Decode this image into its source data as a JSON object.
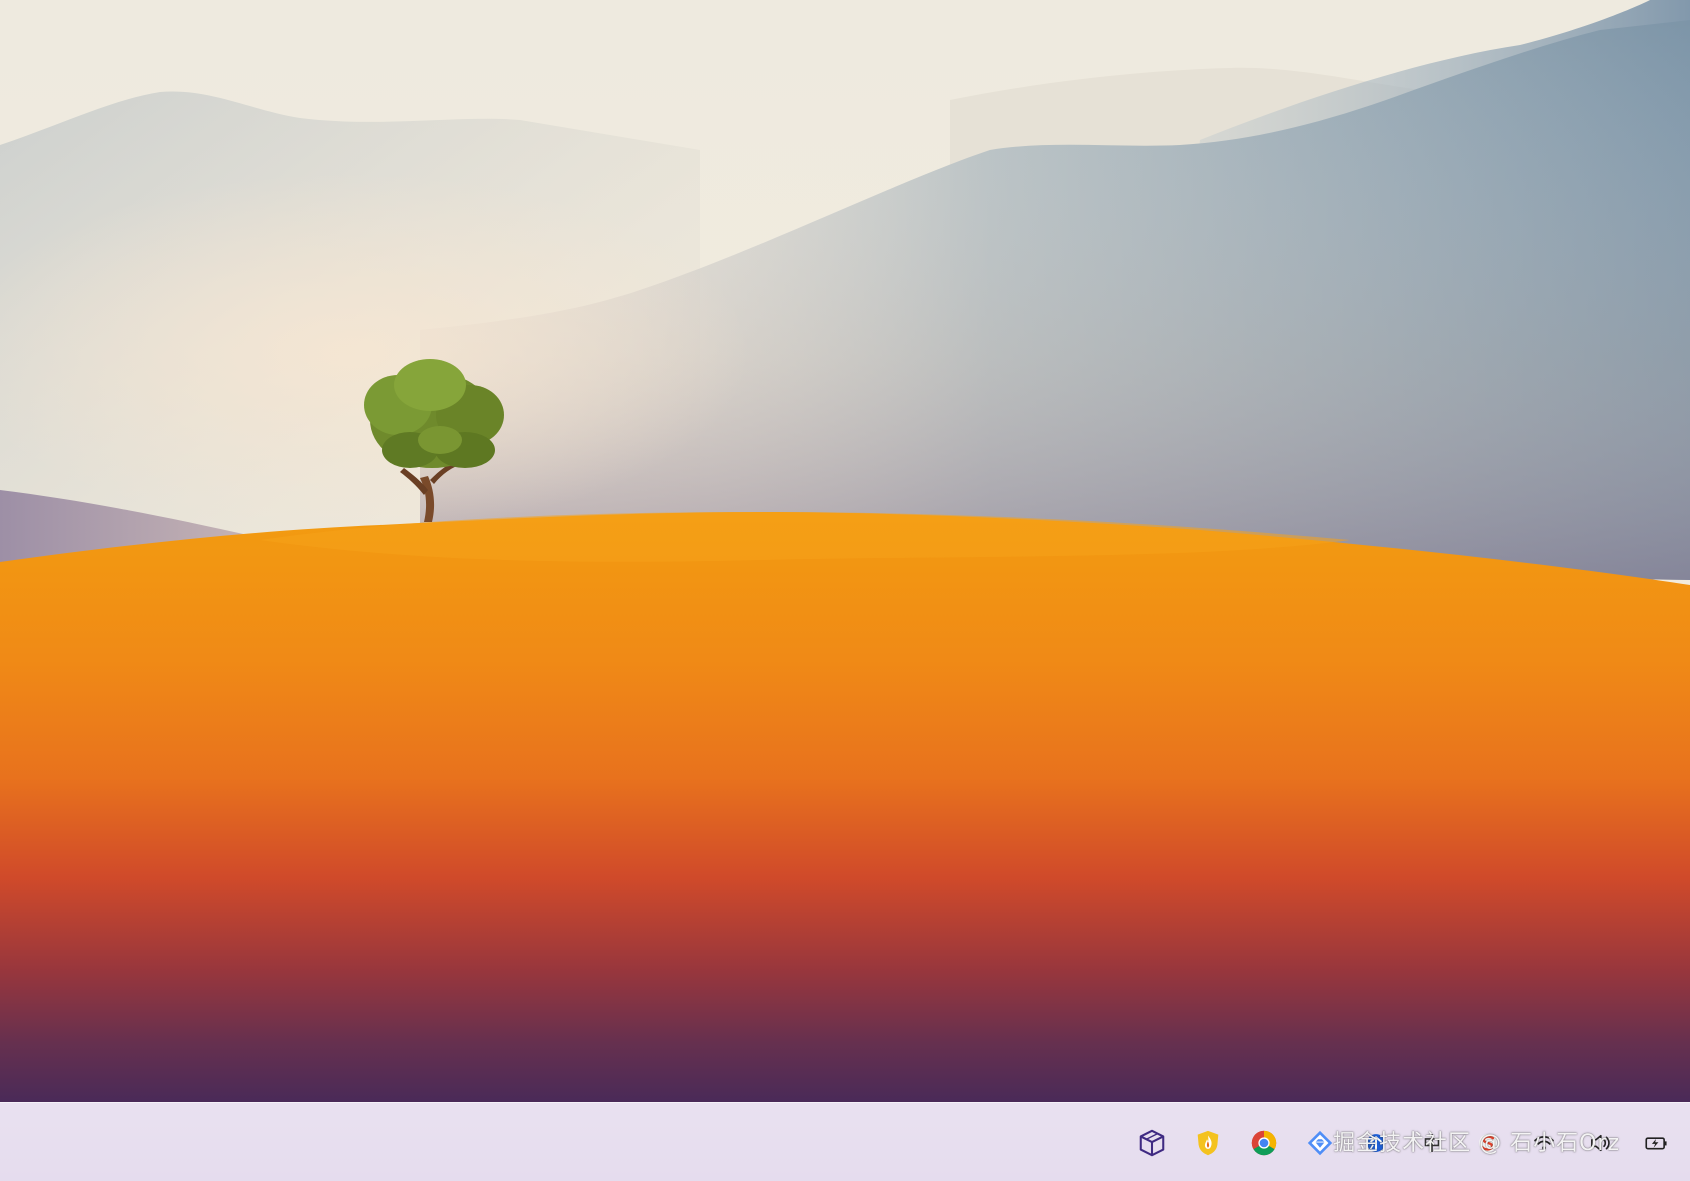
{
  "desktop": {
    "wallpaper": {
      "description_colors": {
        "sky_top": "#efe9db",
        "sky_mid": "#f1ebde",
        "mountain_far": "#d7d3cd",
        "mountain_mid": "#aab8bd",
        "mountain_near": "#7792a8",
        "hill_top": "#f29a12",
        "hill_mid": "#ea7a1c",
        "hill_low": "#c5442c",
        "hill_bottom": "#4e2a58",
        "tree_foliage": "#6f8a2c",
        "tree_trunk": "#7a4a2a"
      }
    }
  },
  "taskbar": {
    "background": "#e7deef",
    "tray_icons": [
      {
        "name": "cube-icon",
        "color": "#3f2a82"
      },
      {
        "name": "shield-flame-icon",
        "color": "#f2b21b"
      },
      {
        "name": "chrome-icon",
        "color": "#4285f4"
      },
      {
        "name": "diamond-gem-icon",
        "color": "#3b82f6"
      },
      {
        "name": "network-icon",
        "color": "#1e5fd6"
      },
      {
        "name": "input-method-icon",
        "color": "#333333"
      },
      {
        "name": "app-s-icon",
        "color": "#e8432b"
      },
      {
        "name": "wifi-icon",
        "color": "#222222"
      },
      {
        "name": "speaker-icon",
        "color": "#222222"
      },
      {
        "name": "battery-icon",
        "color": "#222222"
      }
    ],
    "watermark_text": "掘金技术社区 @ 石小石Orz"
  }
}
